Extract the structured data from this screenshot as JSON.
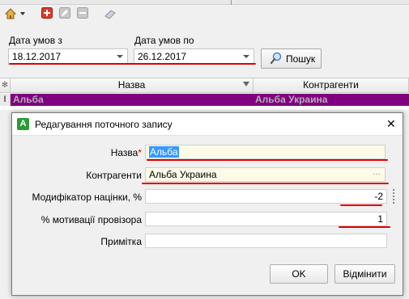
{
  "toolbar": {
    "icons": [
      "home-icon",
      "add-icon",
      "edit-icon",
      "delete-icon",
      "eraser-icon"
    ]
  },
  "filters": {
    "date_from_label": "Дата умов з",
    "date_from_value": "18.12.2017",
    "date_to_label": "Дата умов по",
    "date_to_value": "26.12.2017",
    "search_label": "Пошук"
  },
  "grid": {
    "columns": [
      "Назва",
      "Контрагенти"
    ],
    "selected_row": {
      "name": "Альба",
      "contractor": "Альба Украина",
      "indicator": "I"
    }
  },
  "dialog": {
    "icon_letter": "A",
    "title": "Редагування поточного запису",
    "close_glyph": "✕",
    "fields": {
      "name_label": "Назва",
      "name_required": "*",
      "name_value": "Альба",
      "contractor_label": "Контрагенти",
      "contractor_value": "Альба Украина",
      "contractor_ellipsis": "···",
      "markup_label": "Модифікатор націнки, %",
      "markup_value": "-2",
      "motivation_label": "% мотивації провізора",
      "motivation_value": "1",
      "note_label": "Примітка",
      "note_value": ""
    },
    "ok_label": "OK",
    "cancel_label": "Відмінити"
  },
  "colors": {
    "selected_row_bg": "#800080",
    "highlight_field_bg": "#fdfbe8",
    "annotation_red": "#e00000",
    "title_icon_green": "#2e9a3a"
  }
}
